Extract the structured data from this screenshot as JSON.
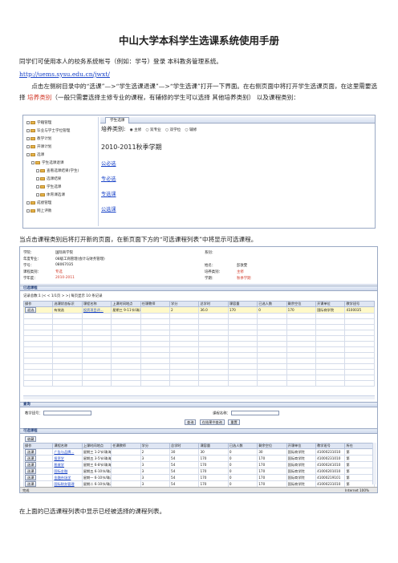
{
  "title": "中山大学本科学生选课系统使用手册",
  "intro": "同学们可使用本人的校务系统帐号（例如：学号）登录 本科教务管理系统。",
  "url": "http://uems.sysu.edu.cn/jwxt/",
  "para2_a": "点击左侧树目录中的“选课”—>“学生选课退课”—>“学生选课”打开一下界面。在右侧页面中将打开学生选课页面，在这里需要选择 ",
  "para2_red": "培养类别",
  "para2_b": "（一般只需要选择主修专业的课程，有辅修的学生可以选择 其他培养类别） 以及课程类别：",
  "shot1": {
    "tab": "学生选课",
    "tree": [
      "学籍管理",
      "毕业与学士学位管理",
      "教学计划",
      "开课计划",
      "选课",
      "学生选课退课",
      "查看选课结果(学生)",
      "选课结果",
      "学生选课",
      "体育课选课",
      "成绩管理",
      "网上评教"
    ],
    "category_label": "培养类别:",
    "options": [
      "主修",
      "双专业",
      "双学位",
      "辅修"
    ],
    "term": "2010-2011秋季学期",
    "links": [
      "公必选",
      "专必选",
      "专选课",
      "公选课"
    ]
  },
  "para3": "当点击课程类别后将打开新的页面，在新页面下方的“可选课程列表”中将显示可选课程。",
  "shot2": {
    "info": [
      [
        "学院：",
        "国际商学院",
        "系别：",
        ""
      ],
      [
        "年度专业：",
        "08级工商管理(会计与财务管理)",
        "",
        ""
      ],
      [
        "学号：",
        "08067035",
        "姓名：",
        "彭敦雯"
      ],
      [
        "课程类别：",
        "专选",
        "培养类别：",
        "主修"
      ],
      [
        "学年度：",
        "2010-2011",
        "学期：",
        "秋季学期"
      ]
    ],
    "selected_head": "已选课程",
    "pager": "记录总数:1  |<  <  1/1页  >  >|  每页显示 10 条记录",
    "cols": [
      "操作",
      "选课状态标识",
      "课程名称",
      "上课时间地点",
      "任课教师",
      "学分",
      "总学时",
      "课容量",
      "已选人数",
      "剩余空位",
      "开课单位",
      "教学班号"
    ],
    "selected_rows": [
      [
        "退选",
        "有效选",
        "投资项目评...",
        "星期三 9-11节/珠海D201(1-...",
        "",
        "2",
        "36.0",
        "170",
        "0",
        "170",
        "国际商学院",
        "4100035"
      ]
    ],
    "query_head": "查询",
    "q_fields": [
      "教学班号：",
      "课程名称："
    ],
    "q_buttons": [
      "查询",
      "在结果中查询",
      "重置"
    ],
    "avail_head": "可选课程",
    "avail_btn": "收藏",
    "avail_cols": [
      "操作",
      "课程名称",
      "上课时间地点",
      "任课教师",
      "学分",
      "总学时",
      "课容量",
      "已选人数",
      "剩余空位",
      "开课单位",
      "教学班号",
      "所在"
    ],
    "avail_rows": [
      [
        "选课",
        "广告与品牌...",
        "星期三 1-2节/珠海D201(1-...",
        "",
        "2",
        "30",
        "30",
        "0",
        "30",
        "国际商学院",
        "41000231010",
        "第"
      ],
      [
        "选课",
        "投资学",
        "星期五 3-5节/珠海C501(1-...",
        "",
        "3",
        "54",
        "170",
        "0",
        "170",
        "国际商学院",
        "41000231010",
        "第"
      ],
      [
        "选课",
        "税收学",
        "星期三 6-8节/珠海E201(1-...",
        "",
        "3",
        "54",
        "170",
        "0",
        "170",
        "国际商学院",
        "41000241010",
        "第"
      ],
      [
        "选课",
        "国际金融",
        "星期五 6-10节/珠海D307(1-...",
        "",
        "3",
        "54",
        "170",
        "0",
        "170",
        "国际商学院",
        "41000201010",
        "第"
      ],
      [
        "选课",
        "金融市场学",
        "星期一 6-10节/珠海D301(1-...",
        "",
        "3",
        "54",
        "170",
        "0",
        "170",
        "国际商学院",
        "41000219101",
        "第"
      ],
      [
        "选课",
        "国际财务管理",
        "星期二 6-10节/珠海...(1-...",
        "",
        "3",
        "54",
        "170",
        "0",
        "170",
        "国际商学院",
        "41000231010",
        "第"
      ]
    ],
    "status_left": "完成",
    "status_right": "Internet    100%"
  },
  "para4": "在上面的已选课程列表中显示已经被选择的课程列表。"
}
